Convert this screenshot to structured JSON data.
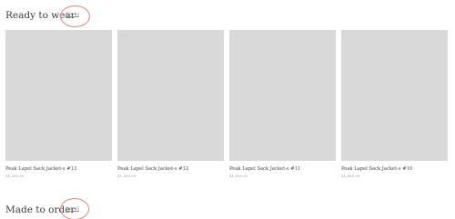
{
  "sections": [
    {
      "title": "Ready to wear",
      "see_all": "See all"
    },
    {
      "title": "Made to order",
      "see_all": "See all"
    }
  ],
  "products": [
    {
      "name": "Peak Lapel Sack Jacket-s #13",
      "price": "$1,200.00"
    },
    {
      "name": "Peak Lapel Sack Jacket-s #12",
      "price": "$1,300.00"
    },
    {
      "name": "Peak Lapel Sack Jacket-s #11",
      "price": "$1,400.00"
    },
    {
      "name": "Peak Lapel Sack Jacket-s #10",
      "price": "$1,400.00"
    }
  ],
  "colors": {
    "image_placeholder": "#d9d9d9",
    "annotation_circle": "#e08a80"
  }
}
